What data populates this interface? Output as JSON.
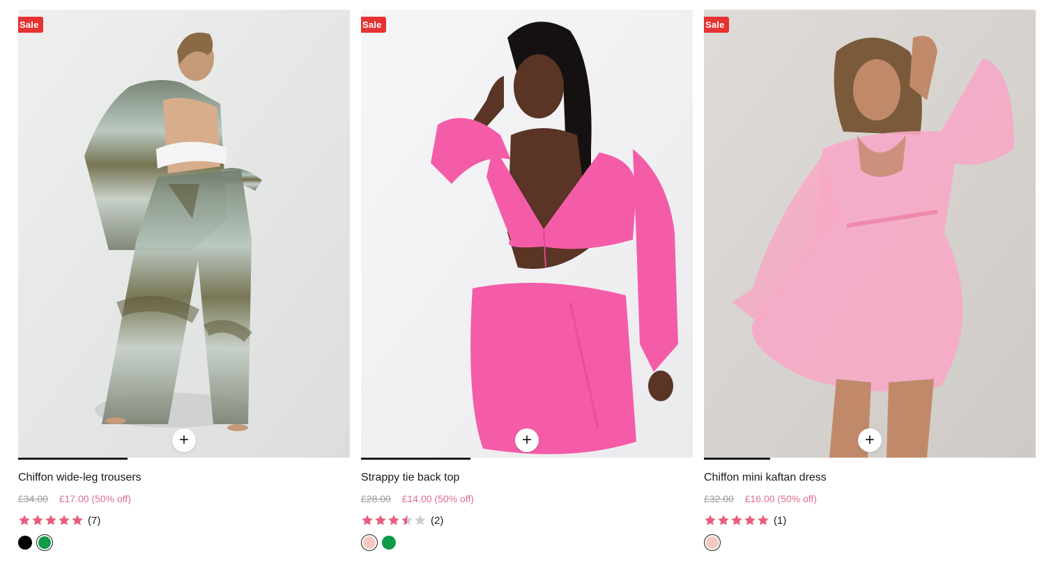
{
  "products": [
    {
      "sale_badge": "Sale",
      "title": "Chiffon wide-leg trousers",
      "old_price": "£34.00",
      "new_price": "£17.00 (50% off)",
      "rating": 5,
      "review_count": "(7)",
      "image_progress": 0.33,
      "swatches": [
        {
          "color": "#000000",
          "selected": false
        },
        {
          "color": "#0f9a4a",
          "selected": true
        }
      ],
      "quick_add_label": "+"
    },
    {
      "sale_badge": "Sale",
      "title": "Strappy tie back top",
      "old_price": "£28.00",
      "new_price": "£14.00 (50% off)",
      "rating": 3.5,
      "review_count": "(2)",
      "image_progress": 0.33,
      "swatches": [
        {
          "color": "#f7c8c2",
          "selected": true
        },
        {
          "color": "#0f9a4a",
          "selected": false
        }
      ],
      "quick_add_label": "+"
    },
    {
      "sale_badge": "Sale",
      "title": "Chiffon mini kaftan dress",
      "old_price": "£32.00",
      "new_price": "£16.00 (50% off)",
      "rating": 5,
      "review_count": "(1)",
      "image_progress": 0.2,
      "swatches": [
        {
          "color": "#f7c8c2",
          "selected": true
        }
      ],
      "quick_add_label": "+"
    }
  ],
  "colors": {
    "sale_badge": "#e63232",
    "star_filled": "#e85d7e",
    "star_empty": "#cfcfcf",
    "sale_price": "#e06c8a"
  }
}
